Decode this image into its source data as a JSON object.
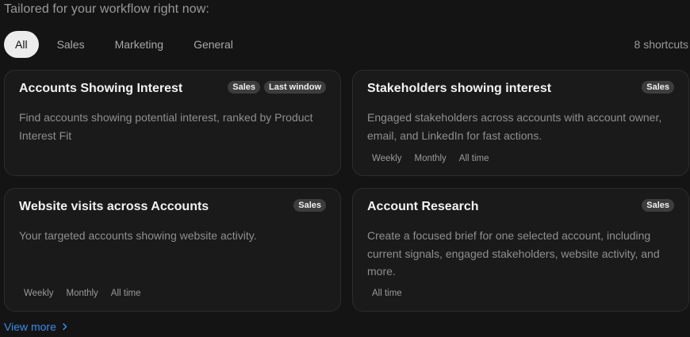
{
  "heading": "Tailored for your workflow right now:",
  "filters": [
    "All",
    "Sales",
    "Marketing",
    "General"
  ],
  "active_filter": "All",
  "shortcut_count": "8 shortcuts",
  "cards": [
    {
      "title": "Accounts Showing Interest",
      "badges": [
        "Sales",
        "Last window"
      ],
      "description": "Find accounts showing potential interest, ranked by Product Interest Fit",
      "ranges": []
    },
    {
      "title": "Stakeholders showing interest",
      "badges": [
        "Sales"
      ],
      "description": "Engaged stakeholders across accounts with account owner, email, and LinkedIn for fast actions.",
      "ranges": [
        "Weekly",
        "Monthly",
        "All time"
      ]
    },
    {
      "title": "Website visits across Accounts",
      "badges": [
        "Sales"
      ],
      "description": "Your targeted accounts showing website activity.",
      "ranges": [
        "Weekly",
        "Monthly",
        "All time"
      ]
    },
    {
      "title": "Account Research",
      "badges": [
        "Sales"
      ],
      "description": "Create a focused brief for one selected account, including current signals, engaged stakeholders, website activity, and more.",
      "ranges": [
        "All time"
      ]
    }
  ],
  "view_more": "View more",
  "icons": {
    "view_more": "chevron-right-icon"
  },
  "colors": {
    "background": "#141414",
    "card": "#1a1a1a",
    "accent_link": "#3d8be8",
    "active_chip": "#ececec"
  }
}
